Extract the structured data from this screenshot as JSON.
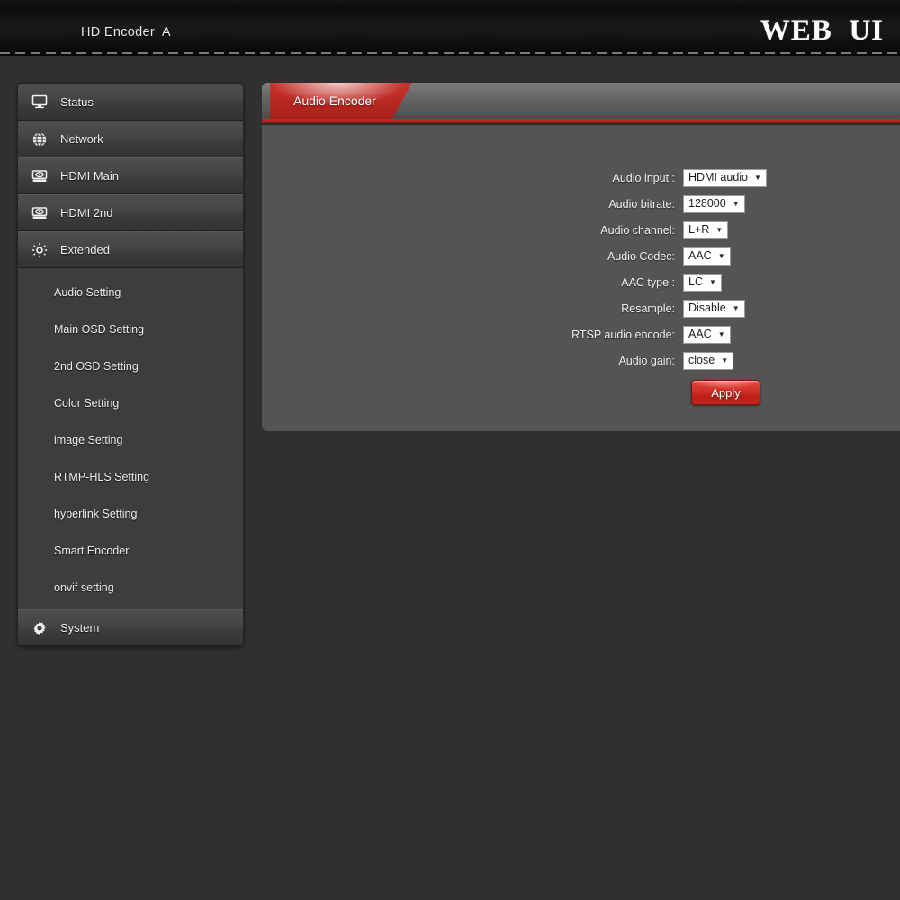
{
  "header": {
    "title": "HD Encoder  A",
    "logo": "WEB  UI"
  },
  "sidebar": {
    "nav": [
      {
        "label": "Status",
        "icon": "monitor-icon"
      },
      {
        "label": "Network",
        "icon": "globe-icon"
      },
      {
        "label": "HDMI Main",
        "icon": "hdmi-device-icon"
      },
      {
        "label": "HDMI 2nd",
        "icon": "hdmi-device-icon"
      },
      {
        "label": "Extended",
        "icon": "sun-settings-icon"
      }
    ],
    "submenu": [
      {
        "label": "Audio Setting"
      },
      {
        "label": "Main OSD Setting"
      },
      {
        "label": "2nd OSD Setting"
      },
      {
        "label": "Color Setting"
      },
      {
        "label": "image Setting"
      },
      {
        "label": "RTMP-HLS Setting"
      },
      {
        "label": "hyperlink Setting"
      },
      {
        "label": "Smart Encoder"
      },
      {
        "label": "onvif setting"
      }
    ],
    "system": {
      "label": "System",
      "icon": "gear-icon"
    }
  },
  "content": {
    "tab_label": "Audio Encoder",
    "fields": [
      {
        "label": "Audio input :",
        "value": "HDMI audio"
      },
      {
        "label": "Audio bitrate:",
        "value": "128000"
      },
      {
        "label": "Audio channel:",
        "value": "L+R"
      },
      {
        "label": "Audio Codec:",
        "value": "AAC"
      },
      {
        "label": "AAC type :",
        "value": "LC"
      },
      {
        "label": "Resample:",
        "value": "Disable"
      },
      {
        "label": "RTSP audio encode:",
        "value": "AAC"
      },
      {
        "label": "Audio gain:",
        "value": "close"
      }
    ],
    "apply_label": "Apply",
    "arrow_glyph": "▼"
  },
  "colors": {
    "accent_red": "#bb2a23",
    "page_bg": "#303030",
    "panel_bg": "#545454",
    "sidebar_bg": "#3d3d3d"
  }
}
